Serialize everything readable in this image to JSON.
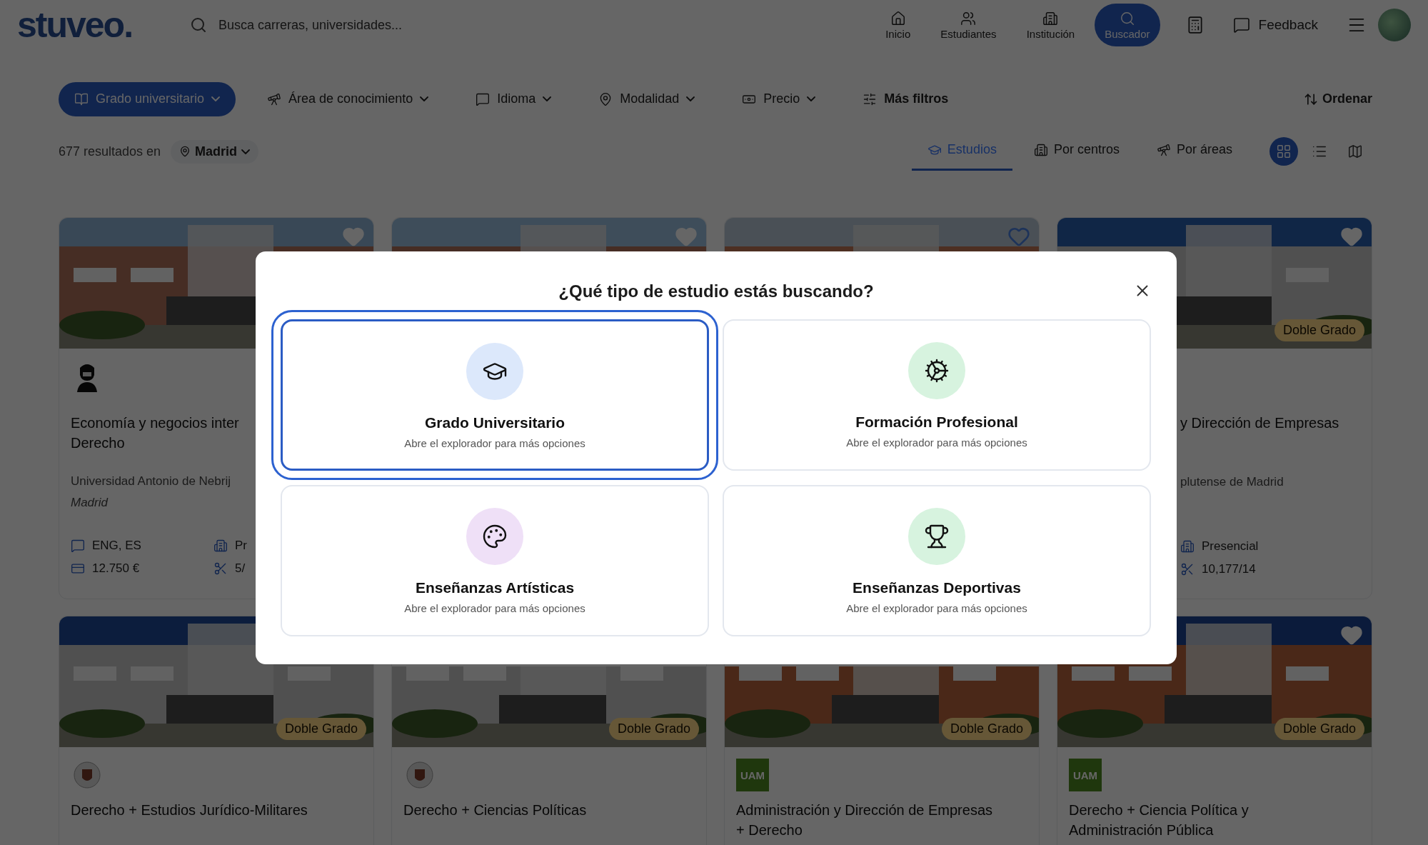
{
  "header": {
    "logo": "stuveo.",
    "search": {
      "placeholder": "Busca carreras, universidades..."
    },
    "nav": [
      {
        "label": "Inicio",
        "selected": false
      },
      {
        "label": "Estudiantes",
        "selected": false
      },
      {
        "label": "Institución",
        "selected": false
      },
      {
        "label": "Buscador",
        "selected": true
      }
    ],
    "feedback": "Feedback"
  },
  "filters": [
    {
      "label": "Grado universitario",
      "selected": true,
      "bold": false
    },
    {
      "label": "Área de conocimiento",
      "selected": false,
      "bold": false
    },
    {
      "label": "Idioma",
      "selected": false,
      "bold": false
    },
    {
      "label": "Modalidad",
      "selected": false,
      "bold": false
    },
    {
      "label": "Precio",
      "selected": false,
      "bold": false
    },
    {
      "label": "Más filtros",
      "selected": false,
      "bold": true
    }
  ],
  "sort": "Ordenar",
  "results": {
    "count": "677 resultados en",
    "location": "Madrid"
  },
  "tabs": [
    {
      "label": "Estudios",
      "selected": true
    },
    {
      "label": "Por centros",
      "selected": false
    },
    {
      "label": "Por áreas",
      "selected": false
    }
  ],
  "views": [
    {
      "selected": true
    },
    {
      "selected": false
    },
    {
      "selected": false
    }
  ],
  "cards": [
    {
      "favorite": true,
      "logo": {
        "kind": "bust"
      },
      "title": [
        "Economía y negocios inter",
        "Derecho"
      ],
      "university": "Universidad Antonio de Nebrij",
      "city": "Madrid",
      "meta": [
        {
          "kind": "language",
          "text": "ENG, ES"
        },
        {
          "kind": "mode",
          "text": "Pr"
        },
        {
          "kind": "price",
          "text": "12.750 €"
        },
        {
          "kind": "cutoff",
          "text": "5/"
        }
      ]
    },
    {
      "favorite": true
    },
    {
      "favorite": false
    },
    {
      "favorite": true,
      "badge": "Doble Grado",
      "title": [
        "y Dirección de Empresas"
      ],
      "university": "plutense de Madrid",
      "meta": [
        {
          "kind": "mode",
          "text": "Presencial"
        },
        {
          "kind": "cutoff",
          "text": "10,177/14"
        }
      ]
    },
    {
      "badge": "Doble Grado",
      "logo": {
        "kind": "crest"
      },
      "title": [
        "Derecho + Estudios Jurídico-Militares"
      ]
    },
    {
      "badge": "Doble Grado",
      "logo": {
        "kind": "crest"
      },
      "title": [
        "Derecho + Ciencias Políticas"
      ]
    },
    {
      "badge": "Doble Grado",
      "logo": {
        "kind": "uam",
        "text": "UAM"
      },
      "title": [
        "Administración y Dirección de Empresas",
        "+ Derecho"
      ]
    },
    {
      "favorite": true,
      "badge": "Doble Grado",
      "logo": {
        "kind": "uam",
        "text": "UAM"
      },
      "title": [
        "Derecho + Ciencia Política y",
        "Administración Pública"
      ]
    }
  ],
  "modal": {
    "title": "¿Qué tipo de estudio estás buscando?",
    "options": [
      {
        "title": "Grado Universitario",
        "subtitle": "Abre el explorador para más opciones",
        "selected": true
      },
      {
        "title": "Formación Profesional",
        "subtitle": "Abre el explorador para más opciones",
        "selected": false
      },
      {
        "title": "Enseñanzas Artísticas",
        "subtitle": "Abre el explorador para más opciones",
        "selected": false
      },
      {
        "title": "Enseñanzas Deportivas",
        "subtitle": "Abre el explorador para más opciones",
        "selected": false
      }
    ]
  }
}
